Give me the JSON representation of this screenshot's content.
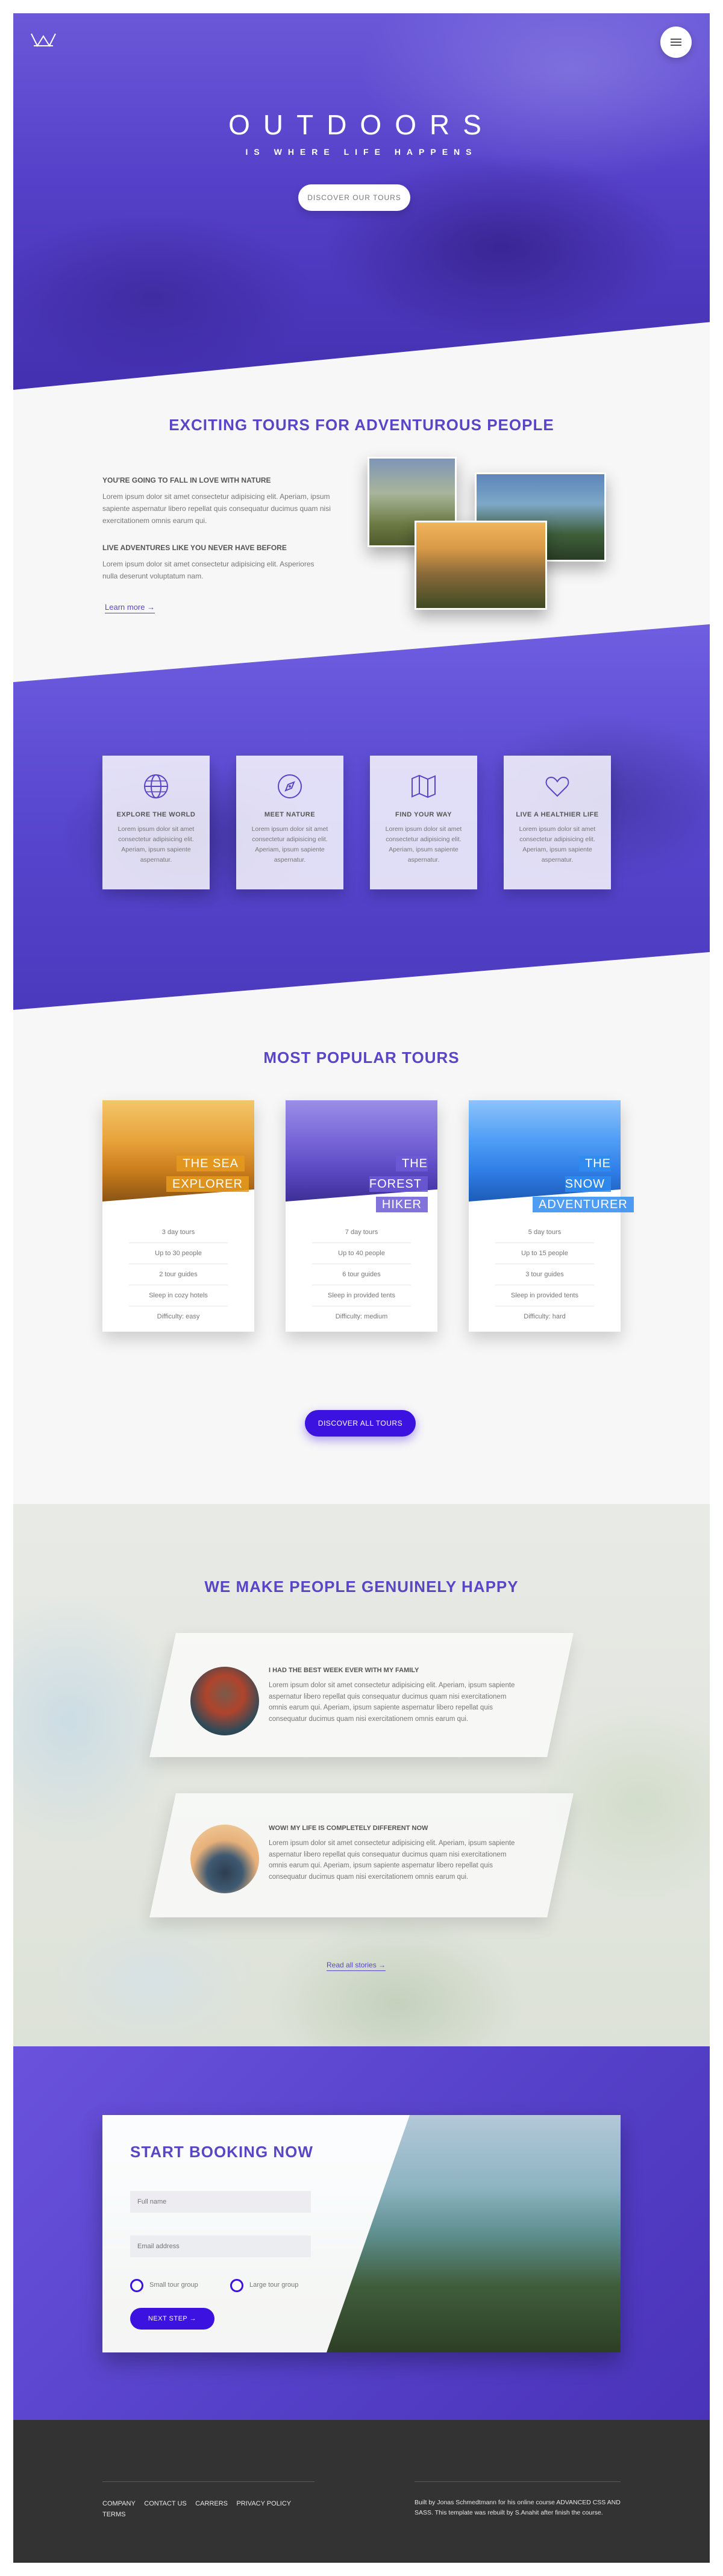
{
  "hero": {
    "title": "OUTDOORS",
    "subtitle": "IS WHERE LIFE HAPPENS",
    "button_label": "DISCOVER OUR TOURS",
    "logo_icon": "mountain-crown-logo",
    "menu_icon": "hamburger-icon"
  },
  "about": {
    "title": "EXCITING TOURS FOR ADVENTUROUS PEOPLE",
    "heading_1": "YOU'RE GOING TO FALL IN LOVE WITH NATURE",
    "text_1": "Lorem ipsum dolor sit amet consectetur adipisicing elit. Aperiam, ipsum sapiente aspernatur libero repellat quis consequatur ducimus quam nisi exercitationem omnis earum qui.",
    "heading_2": "LIVE ADVENTURES LIKE YOU NEVER HAVE BEFORE",
    "text_2": "Lorem ipsum dolor sit amet consectetur adipisicing elit. Asperiores nulla deserunt voluptatum nam.",
    "link_label": "Learn more →"
  },
  "features": [
    {
      "icon": "globe-icon",
      "title": "EXPLORE THE WORLD",
      "text": "Lorem ipsum dolor sit amet consectetur adipisicing elit. Aperiam, ipsum sapiente aspernatur."
    },
    {
      "icon": "compass-icon",
      "title": "MEET NATURE",
      "text": "Lorem ipsum dolor sit amet consectetur adipisicing elit. Aperiam, ipsum sapiente aspernatur."
    },
    {
      "icon": "map-icon",
      "title": "FIND YOUR WAY",
      "text": "Lorem ipsum dolor sit amet consectetur adipisicing elit. Aperiam, ipsum sapiente aspernatur."
    },
    {
      "icon": "heart-icon",
      "title": "LIVE A HEALTHIER LIFE",
      "text": "Lorem ipsum dolor sit amet consectetur adipisicing elit. Aperiam, ipsum sapiente aspernatur."
    }
  ],
  "tours": {
    "title": "MOST POPULAR TOURS",
    "cards": [
      {
        "name_line_1": "THE SEA",
        "name_line_2": "EXPLORER",
        "accent": "#e69a1e",
        "details": [
          "3 day tours",
          "Up to 30 people",
          "2 tour guides",
          "Sleep in cozy hotels",
          "Difficulty: easy"
        ]
      },
      {
        "name_line_1": "THE FOREST",
        "name_line_2": "HIKER",
        "accent": "#6c5ad6",
        "details": [
          "7 day tours",
          "Up to 40 people",
          "6 tour guides",
          "Sleep in provided tents",
          "Difficulty: medium"
        ]
      },
      {
        "name_line_1": "THE SNOW",
        "name_line_2": "ADVENTURER",
        "accent": "#2f8cf0",
        "details": [
          "5 day tours",
          "Up to 15 people",
          "3 tour guides",
          "Sleep in provided tents",
          "Difficulty: hard"
        ]
      }
    ],
    "button_label": "DISCOVER ALL TOURS"
  },
  "stories": {
    "title": "WE MAKE PEOPLE GENUINELY HAPPY",
    "items": [
      {
        "heading": "I HAD THE BEST WEEK EVER WITH MY FAMILY",
        "text": "Lorem ipsum dolor sit amet consectetur adipisicing elit. Aperiam, ipsum sapiente aspernatur libero repellat quis consequatur ducimus quam nisi exercitationem omnis earum qui. Aperiam, ipsum sapiente aspernatur libero repellat quis consequatur ducimus quam nisi exercitationem omnis earum qui."
      },
      {
        "heading": "WOW! MY LIFE IS COMPLETELY DIFFERENT NOW",
        "text": "Lorem ipsum dolor sit amet consectetur adipisicing elit. Aperiam, ipsum sapiente aspernatur libero repellat quis consequatur ducimus quam nisi exercitationem omnis earum qui. Aperiam, ipsum sapiente aspernatur libero repellat quis consequatur ducimus quam nisi exercitationem omnis earum qui."
      }
    ],
    "link_label": "Read all stories →"
  },
  "booking": {
    "title": "START BOOKING NOW",
    "name_placeholder": "Full name",
    "email_placeholder": "Email address",
    "radio_small": "Small tour group",
    "radio_large": "Large tour group",
    "button_label": "NEXT STEP →"
  },
  "footer": {
    "nav": [
      "COMPANY",
      "CONTACT US",
      "CARRERS",
      "PRIVACY POLICY",
      "TERMS"
    ],
    "copyright": "Built by Jonas Schmedtmann for his online course ADVANCED CSS AND SASS. This template was rebuilt by S.Anahit after finish the course."
  },
  "colors": {
    "primary": "#5a45c6",
    "button_blue": "#3b12e0",
    "footer_bg": "#333333"
  }
}
